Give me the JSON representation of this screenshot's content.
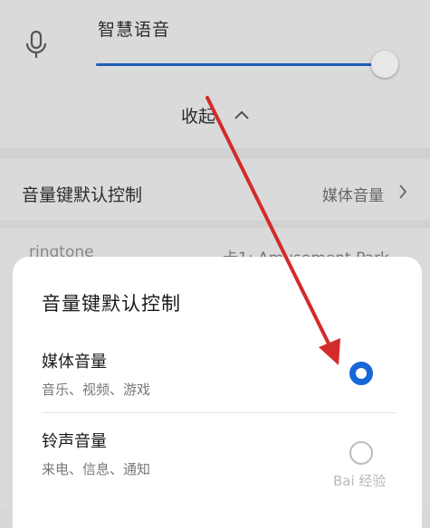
{
  "voice": {
    "title": "智慧语音",
    "mic_icon": "microphone-icon",
    "slider_level": 0.95,
    "accent": "#1f5fb8"
  },
  "collapse": {
    "label": "收起",
    "icon": "chevron-up-icon"
  },
  "setting_row": {
    "label": "音量键默认控制",
    "value": "媒体音量",
    "icon": "chevron-right-icon"
  },
  "sim_row": {
    "label": "ringtone",
    "value": "卡1: Amusement Park"
  },
  "sheet": {
    "title": "音量键默认控制",
    "options": [
      {
        "title": "媒体音量",
        "subtitle": "音乐、视频、游戏",
        "selected": true
      },
      {
        "title": "铃声音量",
        "subtitle": "来电、信息、通知",
        "selected": false
      }
    ],
    "radio_color": "#1667d8"
  },
  "watermark": {
    "text": "Bai 经验"
  },
  "annotation": {
    "arrow_color": "#d42a2a"
  }
}
